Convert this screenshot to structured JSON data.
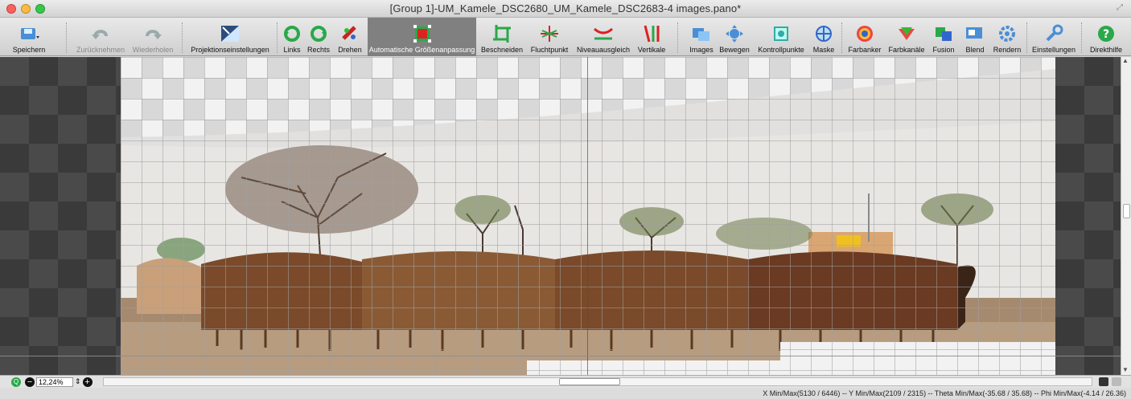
{
  "window": {
    "title": "[Group 1]-UM_Kamele_DSC2680_UM_Kamele_DSC2683-4 images.pano*"
  },
  "toolbar": {
    "items": [
      {
        "label": "Speichern",
        "icon": "save-icon"
      },
      {
        "label": "Zurücknehmen",
        "icon": "undo-icon"
      },
      {
        "label": "Wiederholen",
        "icon": "redo-icon"
      },
      {
        "label": "Projektionseinstellungen",
        "icon": "projection-icon"
      },
      {
        "label": "Links",
        "icon": "rotate-left-icon"
      },
      {
        "label": "Rechts",
        "icon": "rotate-right-icon"
      },
      {
        "label": "Drehen",
        "icon": "rotate-icon"
      },
      {
        "label": "Automatische Größenanpassung",
        "icon": "auto-size-icon"
      },
      {
        "label": "Beschneiden",
        "icon": "crop-icon"
      },
      {
        "label": "Fluchtpunkt",
        "icon": "vanishing-point-icon"
      },
      {
        "label": "Niveauausgleich",
        "icon": "level-icon"
      },
      {
        "label": "Vertikale",
        "icon": "vertical-icon"
      },
      {
        "label": "Images",
        "icon": "images-icon"
      },
      {
        "label": "Bewegen",
        "icon": "move-icon"
      },
      {
        "label": "Kontrollpunkte",
        "icon": "control-points-icon"
      },
      {
        "label": "Maske",
        "icon": "mask-icon"
      },
      {
        "label": "Farbanker",
        "icon": "color-anchor-icon"
      },
      {
        "label": "Farbkanäle",
        "icon": "color-channels-icon"
      },
      {
        "label": "Fusion",
        "icon": "fusion-icon"
      },
      {
        "label": "Blend",
        "icon": "blend-icon"
      },
      {
        "label": "Rendern",
        "icon": "render-icon"
      },
      {
        "label": "Einstellungen",
        "icon": "settings-icon"
      },
      {
        "label": "Direkthilfe",
        "icon": "help-icon"
      }
    ]
  },
  "zoom": {
    "value": "12,24%"
  },
  "status": {
    "text": "X Min/Max(5130 / 6446)  --  Y Min/Max(2109 / 2315)  --  Theta Min/Max(-35.68 / 35.68)  --  Phi Min/Max(-4.14 / 26.36)"
  },
  "colors": {
    "active_tool_bg": "#808080",
    "canvas_bg": "#3a3a3a"
  }
}
